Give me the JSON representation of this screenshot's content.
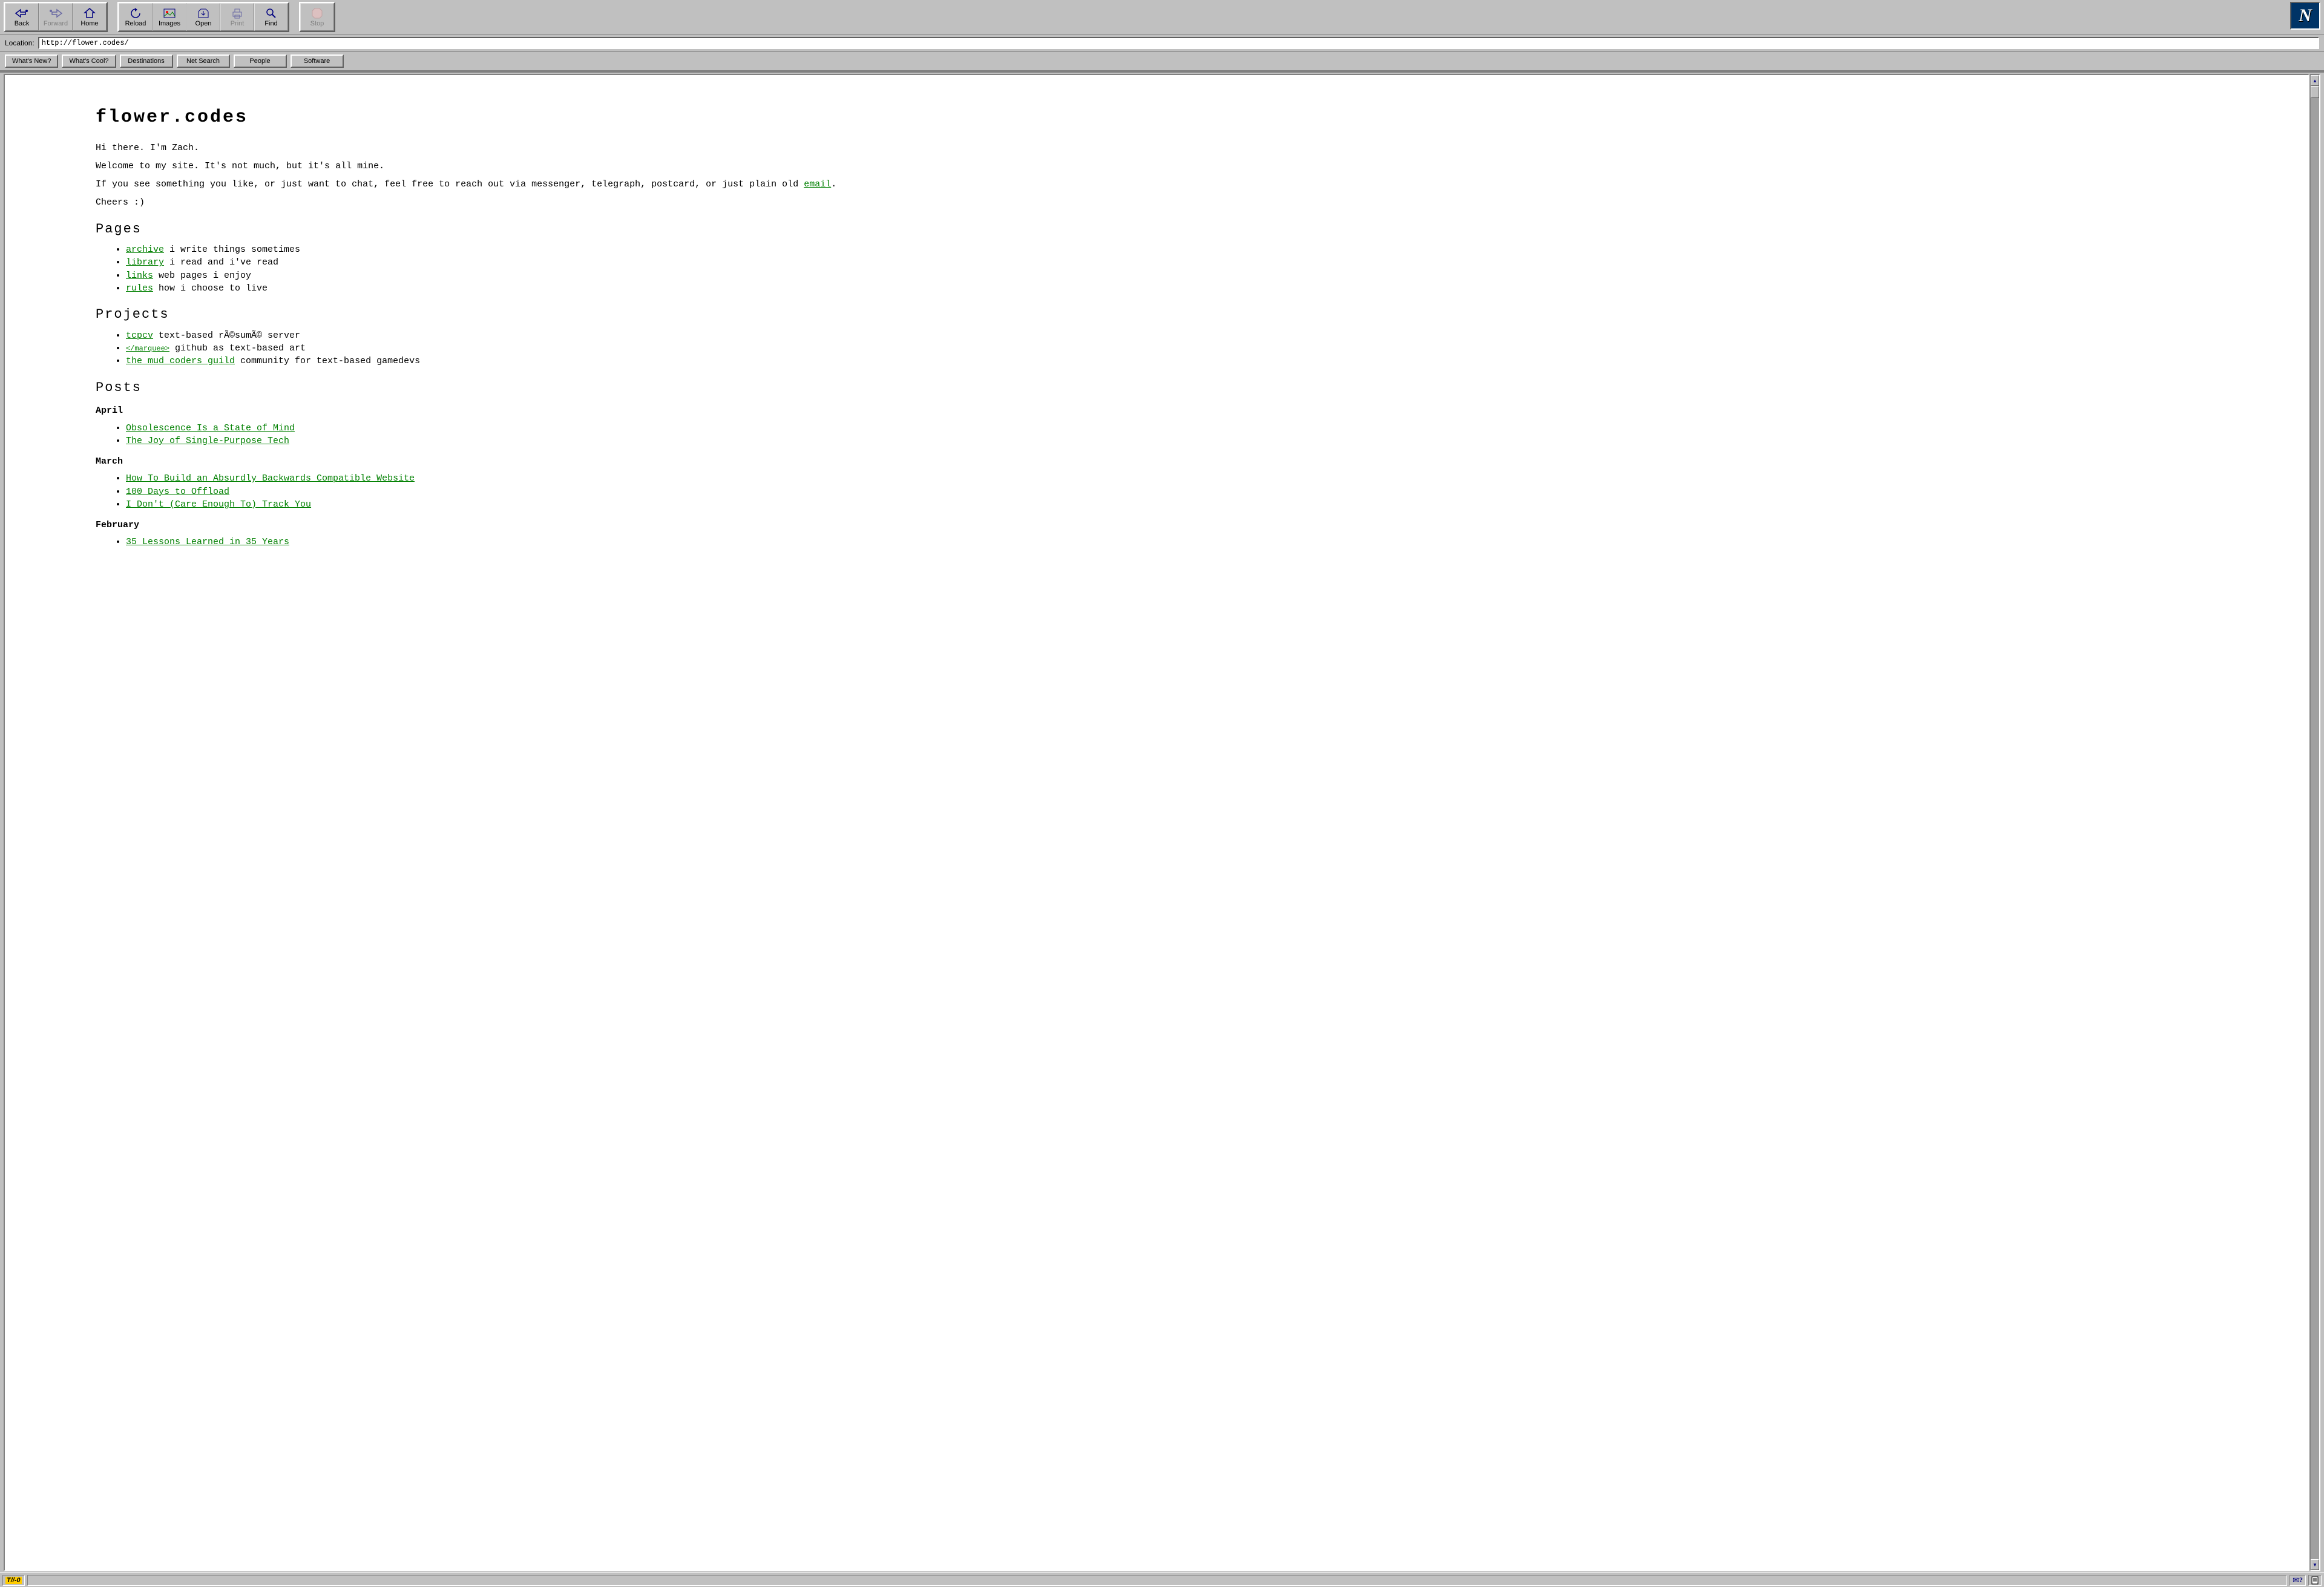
{
  "toolbar": {
    "back": "Back",
    "forward": "Forward",
    "home": "Home",
    "reload": "Reload",
    "images": "Images",
    "open": "Open",
    "print": "Print",
    "find": "Find",
    "stop": "Stop"
  },
  "location": {
    "label": "Location:",
    "url": "http://flower.codes/"
  },
  "dirbar": [
    "What's New?",
    "What's Cool?",
    "Destinations",
    "Net Search",
    "People",
    "Software"
  ],
  "page": {
    "title": "flower.codes",
    "intro_p1": "Hi there. I'm Zach.",
    "intro_p2": "Welcome to my site. It's not much, but it's all mine.",
    "intro_p3a": "If you see something you like, or just want to chat, feel free to reach out via messenger, telegraph, postcard, or just plain old ",
    "email_link": "email",
    "intro_p3b": ".",
    "cheers": "Cheers :)",
    "pages_h": "Pages",
    "pages": [
      {
        "link": "archive",
        "desc": " i write things sometimes"
      },
      {
        "link": "library",
        "desc": " i read and i've read"
      },
      {
        "link": "links",
        "desc": " web pages i enjoy"
      },
      {
        "link": "rules",
        "desc": " how i choose to live"
      }
    ],
    "projects_h": "Projects",
    "projects": [
      {
        "link": "tcpcv",
        "desc": " text-based rÃ©sumÃ© server"
      },
      {
        "link": "</marquee>",
        "desc": " github as text-based art"
      },
      {
        "link": "the mud coders guild",
        "desc": " community for text-based gamedevs"
      }
    ],
    "posts_h": "Posts",
    "months": [
      {
        "name": "April",
        "posts": [
          "Obsolescence Is a State of Mind",
          "The Joy of Single-Purpose Tech"
        ]
      },
      {
        "name": "March",
        "posts": [
          "How To Build an Absurdly Backwards Compatible Website",
          "100 Days to Offload",
          "I Don't (Care Enough To) Track You"
        ]
      },
      {
        "name": "February",
        "posts": [
          "35 Lessons Learned in 35 Years"
        ]
      }
    ]
  },
  "status": {
    "tho": "T//-0",
    "q": "?"
  }
}
